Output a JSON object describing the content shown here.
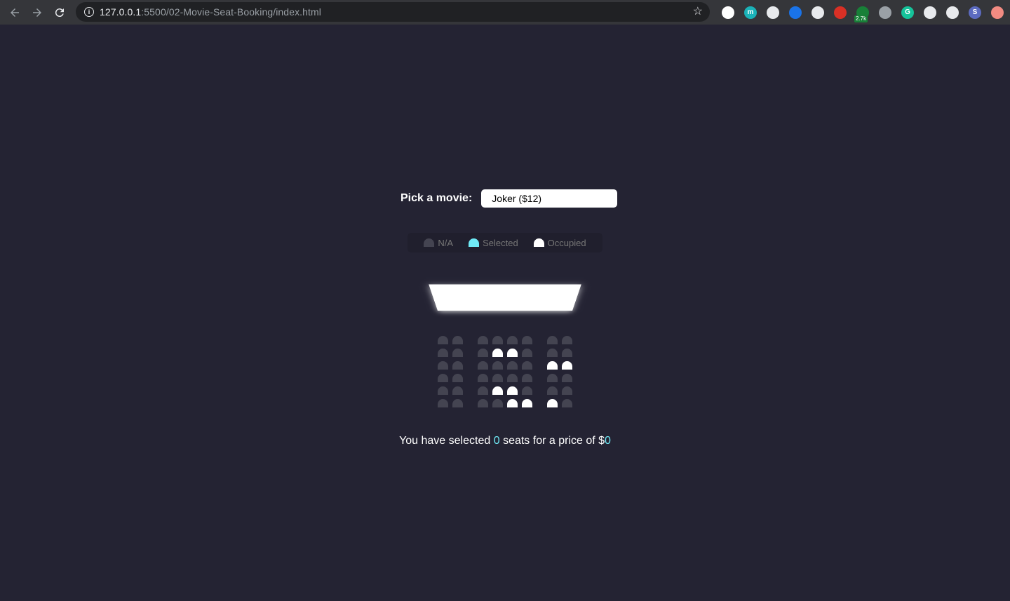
{
  "browser": {
    "url_host": "127.0.0.1",
    "url_rest": ":5500/02-Movie-Seat-Booking/index.html",
    "extensions": [
      {
        "name": "cloud-extension-icon",
        "color": "#ffffff",
        "label": ""
      },
      {
        "name": "m-extension-icon",
        "color": "#1ab2b8",
        "label": "m"
      },
      {
        "name": "document-extension-icon",
        "color": "#e8eaed",
        "label": ""
      },
      {
        "name": "cube-extension-icon",
        "color": "#1a73e8",
        "label": ""
      },
      {
        "name": "cloud-sync-extension-icon",
        "color": "#e8eaed",
        "label": ""
      },
      {
        "name": "hand-extension-icon",
        "color": "#d93025",
        "label": ""
      },
      {
        "name": "cash-extension-icon",
        "color": "#188038",
        "label": "",
        "badge": "2.7k"
      },
      {
        "name": "camera-extension-icon",
        "color": "#9aa0a6",
        "label": ""
      },
      {
        "name": "grammarly-extension-icon",
        "color": "#15c39a",
        "label": "G"
      },
      {
        "name": "puzzle-extension-icon",
        "color": "#e8eaed",
        "label": ""
      },
      {
        "name": "media-extension-icon",
        "color": "#e8eaed",
        "label": ""
      },
      {
        "name": "profile-avatar",
        "color": "#5c6bc0",
        "label": "S"
      },
      {
        "name": "update-icon",
        "color": "#f28b82",
        "label": ""
      }
    ]
  },
  "movie": {
    "label": "Pick a movie:",
    "selected": "Joker ($12)"
  },
  "legend": {
    "na": "N/A",
    "selected": "Selected",
    "occupied": "Occupied"
  },
  "seats": {
    "rows": [
      [
        0,
        0,
        0,
        0,
        0,
        0,
        0,
        0
      ],
      [
        0,
        0,
        0,
        1,
        1,
        0,
        0,
        0
      ],
      [
        0,
        0,
        0,
        0,
        0,
        0,
        1,
        1
      ],
      [
        0,
        0,
        0,
        0,
        0,
        0,
        0,
        0
      ],
      [
        0,
        0,
        0,
        1,
        1,
        0,
        0,
        0
      ],
      [
        0,
        0,
        0,
        0,
        1,
        1,
        1,
        0
      ]
    ]
  },
  "summary": {
    "prefix": "You have selected",
    "count": "0",
    "middle": "seats for a price of $",
    "total": "0"
  },
  "colors": {
    "background": "#242333",
    "seat": "#444451",
    "selected": "#6feaf6",
    "occupied": "#ffffff"
  }
}
